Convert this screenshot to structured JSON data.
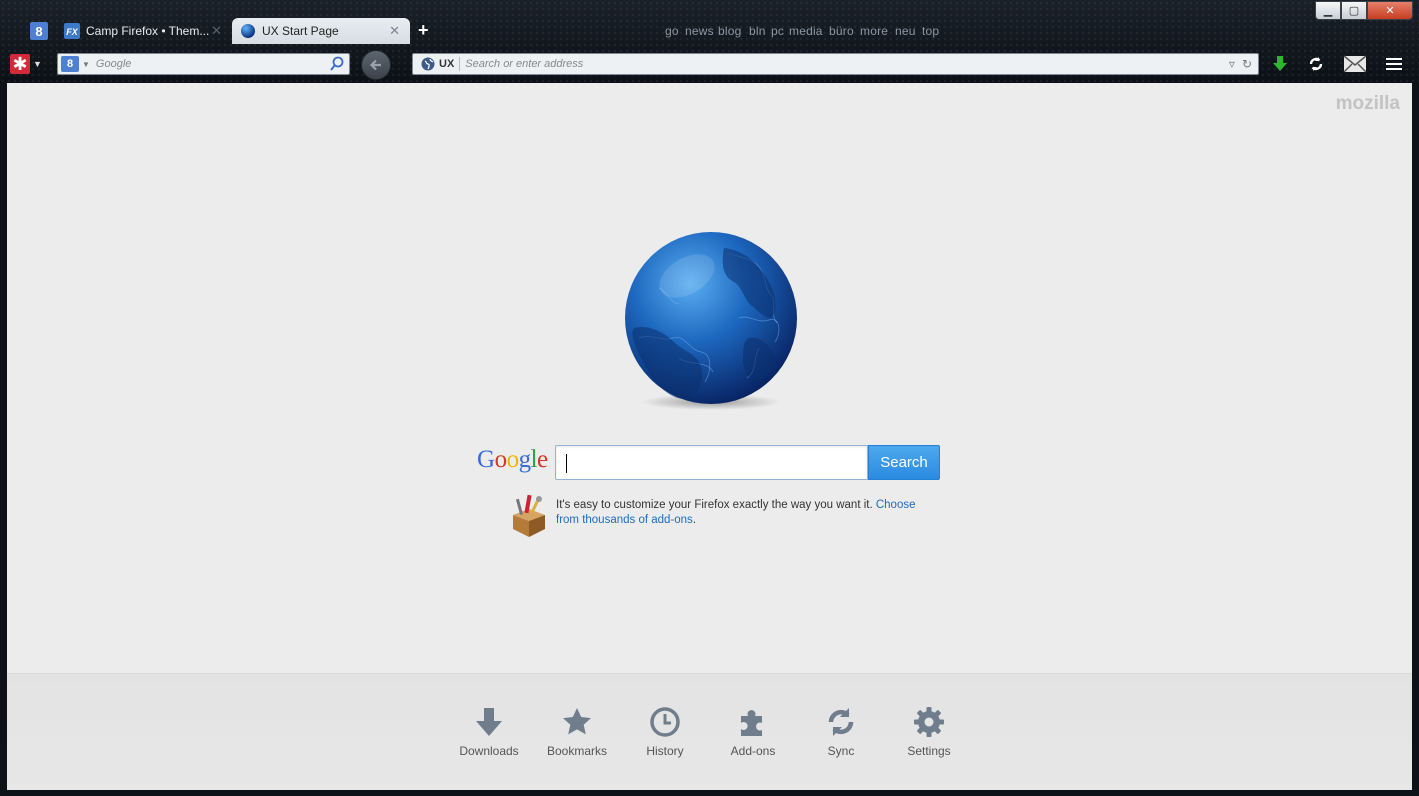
{
  "tabs": {
    "inactive": {
      "label": "Camp Firefox • Them...",
      "close": "✕"
    },
    "active": {
      "label": "UX Start Page",
      "close": "✕"
    },
    "new_tab": "+"
  },
  "bookmarks": [
    "go",
    "news",
    "blog",
    "bln",
    "pc",
    "media",
    "büro",
    "more",
    "neu",
    "top"
  ],
  "window_controls": {
    "minimize": "▁",
    "maximize": "▢",
    "close": "✕"
  },
  "navbar": {
    "search_engine_letter": "8",
    "search_placeholder": "Google",
    "identity_label": "UX",
    "url_placeholder": "Search or enter address"
  },
  "page": {
    "brand": "mozilla",
    "google_logo": [
      "G",
      "o",
      "o",
      "g",
      "l",
      "e"
    ],
    "google_colors": [
      "#3a6ad6",
      "#d6362b",
      "#f1b600",
      "#3a6ad6",
      "#2b9b4a",
      "#d6362b"
    ],
    "search_button": "Search",
    "snippet_text": "It's easy to customize your Firefox exactly the way you want it. ",
    "snippet_link": "Choose from thousands of add-ons",
    "snippet_end": "."
  },
  "launcher": [
    {
      "label": "Downloads",
      "icon": "downloads-icon"
    },
    {
      "label": "Bookmarks",
      "icon": "bookmarks-icon"
    },
    {
      "label": "History",
      "icon": "history-icon"
    },
    {
      "label": "Add-ons",
      "icon": "addons-icon"
    },
    {
      "label": "Sync",
      "icon": "sync-icon"
    },
    {
      "label": "Settings",
      "icon": "settings-icon"
    }
  ],
  "colors": {
    "accent": "#2a8be0",
    "launcher_icon": "#6f7d8c",
    "download_arrow": "#2fb52f"
  }
}
